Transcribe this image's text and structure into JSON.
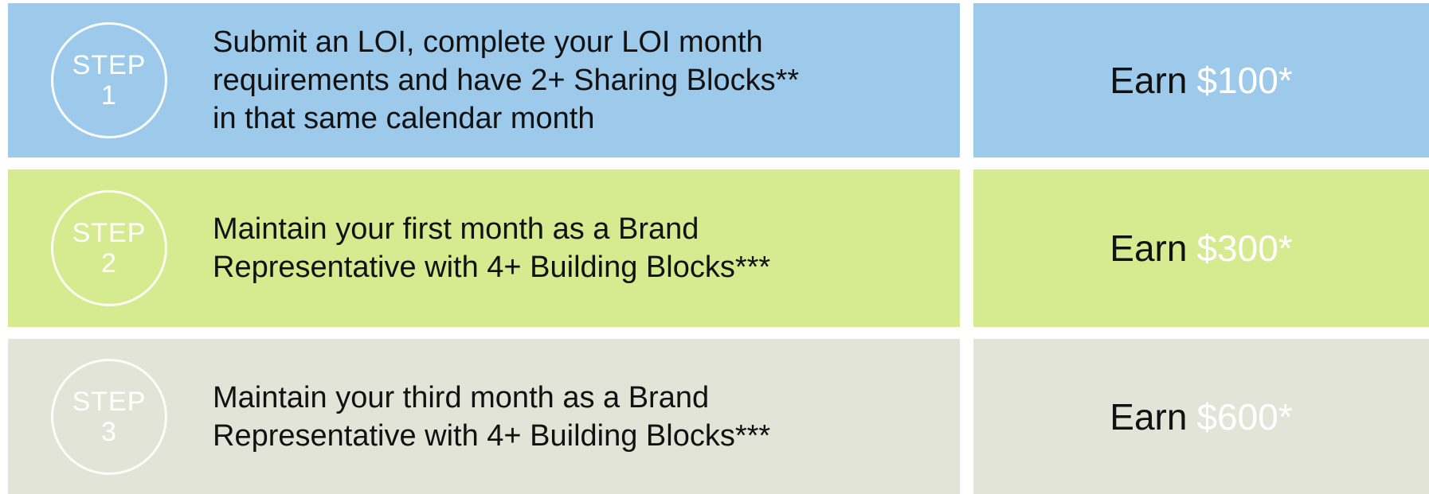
{
  "steps": [
    {
      "step_label": "STEP",
      "step_number": "1",
      "description": "Submit an LOI, complete your LOI month\nrequirements and have 2+ Sharing Blocks**\nin that same calendar month",
      "earn_label": "Earn",
      "amount": "$100*"
    },
    {
      "step_label": "STEP",
      "step_number": "2",
      "description": "Maintain your first month as a Brand\nRepresentative with 4+ Building Blocks***",
      "earn_label": "Earn",
      "amount": "$300*"
    },
    {
      "step_label": "STEP",
      "step_number": "3",
      "description": "Maintain your third month as a Brand\nRepresentative with 4+ Building Blocks***",
      "earn_label": "Earn",
      "amount": "$600*"
    }
  ],
  "colors": {
    "row_1": "#9dcaea",
    "row_2": "#d6ea8f",
    "row_3": "#e3e4d8",
    "text": "#111111",
    "accent": "#ffffff"
  }
}
